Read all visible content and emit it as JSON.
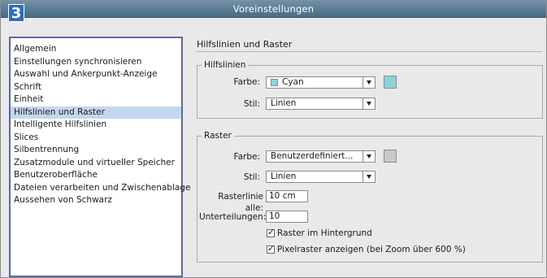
{
  "step_number": "3",
  "window": {
    "title": "Voreinstellungen"
  },
  "categories": {
    "items": [
      {
        "label": "Allgemein"
      },
      {
        "label": "Einstellungen synchronisieren"
      },
      {
        "label": "Auswahl und Ankerpunkt-Anzeige"
      },
      {
        "label": "Schrift"
      },
      {
        "label": "Einheit"
      },
      {
        "label": "Hilfslinien und Raster",
        "selected": true
      },
      {
        "label": "Intelligente Hilfslinien"
      },
      {
        "label": "Slices"
      },
      {
        "label": "Silbentrennung"
      },
      {
        "label": "Zusatzmodule und virtueller Speicher"
      },
      {
        "label": "Benutzeroberfläche"
      },
      {
        "label": "Dateien verarbeiten und Zwischenablage"
      },
      {
        "label": "Aussehen von Schwarz"
      }
    ]
  },
  "panel": {
    "heading": "Hilfslinien und Raster",
    "guides": {
      "group_label": "Hilfslinien",
      "color_label": "Farbe:",
      "color_value": "Cyan",
      "color_hex": "#8fd3d6",
      "style_label": "Stil:",
      "style_value": "Linien"
    },
    "grid": {
      "group_label": "Raster",
      "color_label": "Farbe:",
      "color_value": "Benutzerdefiniert...",
      "color_hex": "#c8c8c8",
      "style_label": "Stil:",
      "style_value": "Linien",
      "gridline_every_label": "Rasterlinie alle:",
      "gridline_every_value": "10 cm",
      "subdivisions_label": "Unterteilungen:",
      "subdivisions_value": "10",
      "grid_in_back_label": "Raster im Hintergrund",
      "grid_in_back_checked": true,
      "pixel_grid_label": "Pixelraster anzeigen (bei Zoom über 600 %)",
      "pixel_grid_checked": true
    }
  },
  "colors": {
    "titlebar": "#5a7c96",
    "selection": "#c5d6f0",
    "badge": "#2e6fb8"
  }
}
